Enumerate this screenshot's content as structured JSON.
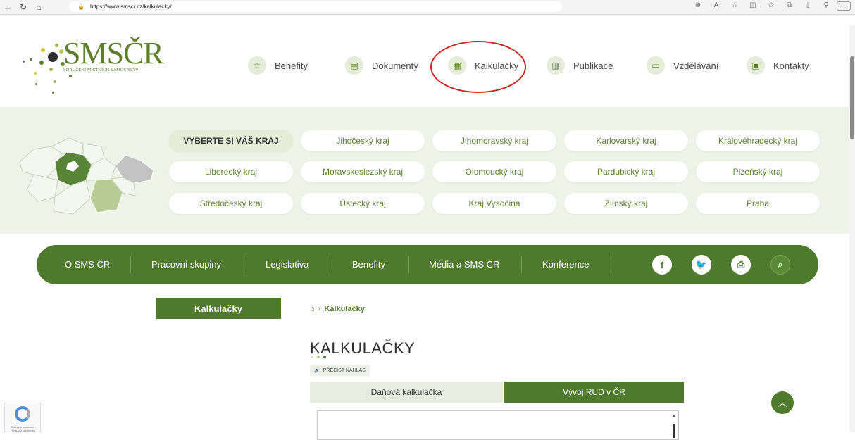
{
  "browser": {
    "url": "https://www.smscr.cz/kalkulacky/"
  },
  "logo": {
    "title": "SMSČR",
    "subtitle": "SDRUŽENÍ MÍSTNÍCH SAMOSPRÁV"
  },
  "top_nav": [
    {
      "label": "Benefity",
      "icon": "star-icon"
    },
    {
      "label": "Dokumenty",
      "icon": "document-icon"
    },
    {
      "label": "Kalkulačky",
      "icon": "calculator-icon"
    },
    {
      "label": "Publikace",
      "icon": "books-icon"
    },
    {
      "label": "Vzdělávání",
      "icon": "education-icon"
    },
    {
      "label": "Kontakty",
      "icon": "contact-card-icon"
    }
  ],
  "regions": {
    "label": "VYBERTE SI VÁŠ KRAJ",
    "items": [
      "Jihočeský kraj",
      "Jihomoravský kraj",
      "Karlovarský kraj",
      "Královéhradecký kraj",
      "Liberecký kraj",
      "Moravskoslezský kraj",
      "Olomoucký kraj",
      "Pardubický kraj",
      "Plzeňský kraj",
      "Středočeský kraj",
      "Ústecký kraj",
      "Kraj Vysočina",
      "Zlínský kraj",
      "Praha"
    ]
  },
  "main_nav": [
    "O SMS ČR",
    "Pracovní skupiny",
    "Legislativa",
    "Benefity",
    "Média a SMS ČR",
    "Konference"
  ],
  "main_nav_icons": [
    "facebook-icon",
    "twitter-icon",
    "print-icon",
    "search-icon"
  ],
  "side_menu": {
    "active": "Kalkulačky"
  },
  "breadcrumb": {
    "current": "Kalkulačky"
  },
  "page": {
    "title": "KALKULAČKY",
    "read_aloud": "PŘEČÍST NAHLAS",
    "tabs": [
      {
        "label": "Daňová kalkulačka",
        "active": false
      },
      {
        "label": "Vývoj RUD v ČR",
        "active": true
      }
    ]
  },
  "recaptcha": {
    "text": "Ochrana soukromí - Smluvní podmínky"
  },
  "colors": {
    "brand": "#4f7a2d",
    "band": "#eef3e7",
    "annotation": "#d21f1f"
  }
}
